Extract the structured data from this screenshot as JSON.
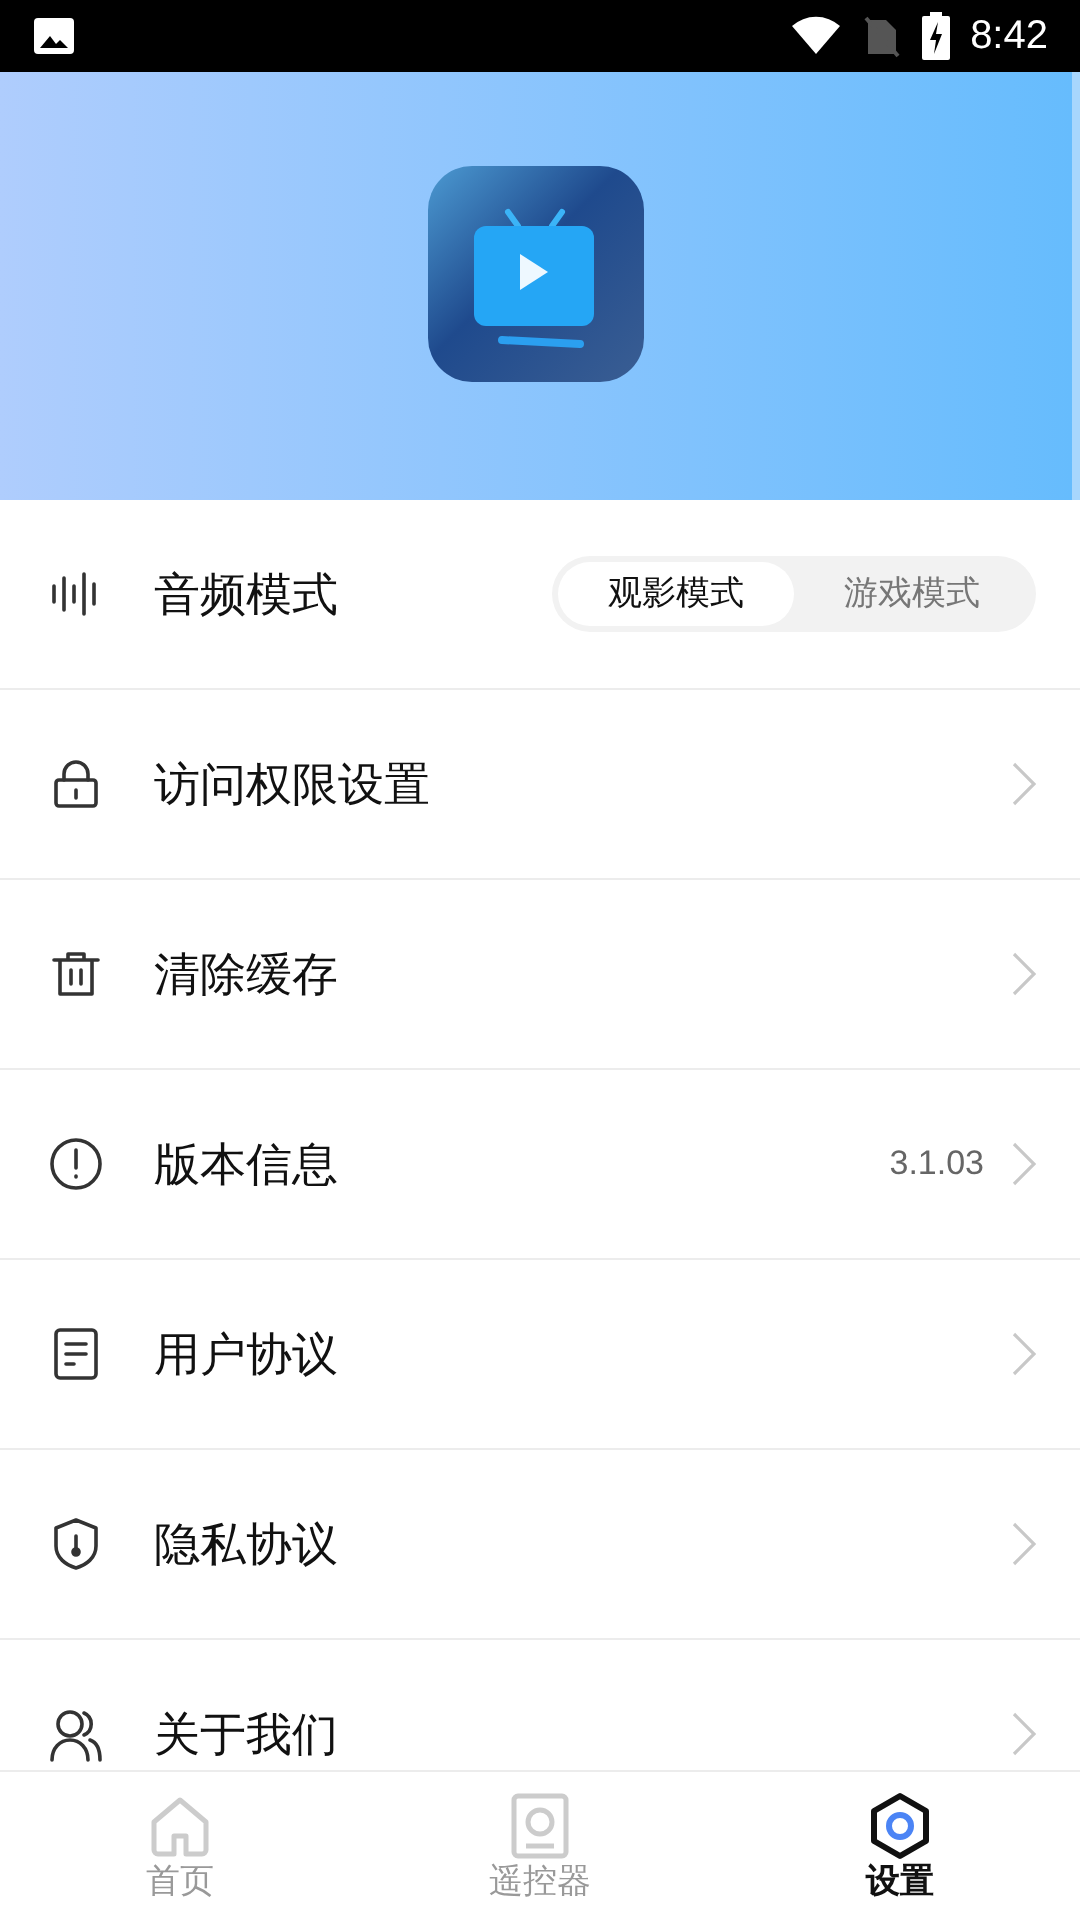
{
  "status_bar": {
    "time": "8:42"
  },
  "settings": [
    {
      "kind": "toggle",
      "label": "音频模式",
      "options": [
        {
          "label": "观影模式",
          "selected": true
        },
        {
          "label": "游戏模式",
          "selected": false
        }
      ]
    },
    {
      "kind": "link",
      "label": "访问权限设置"
    },
    {
      "kind": "link",
      "label": "清除缓存"
    },
    {
      "kind": "link",
      "label": "版本信息",
      "value": "3.1.03"
    },
    {
      "kind": "link",
      "label": "用户协议"
    },
    {
      "kind": "link",
      "label": "隐私协议"
    },
    {
      "kind": "link",
      "label": "关于我们"
    }
  ],
  "bottom_nav": [
    {
      "label": "首页",
      "selected": false
    },
    {
      "label": "遥控器",
      "selected": false
    },
    {
      "label": "设置",
      "selected": true
    }
  ]
}
